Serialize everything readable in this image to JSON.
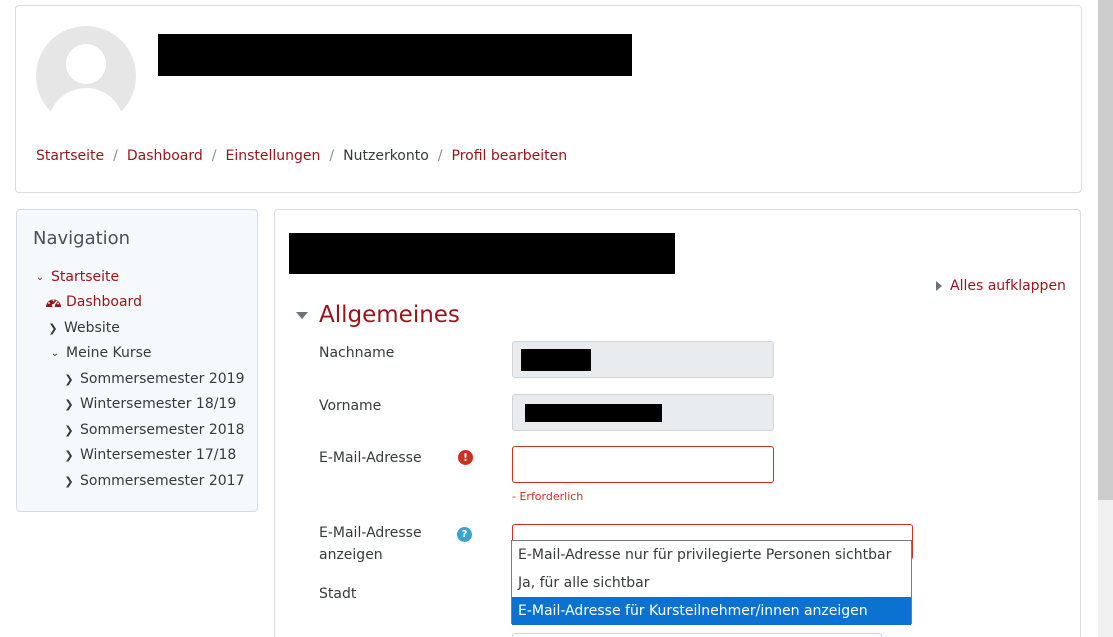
{
  "breadcrumb": {
    "items": [
      "Startseite",
      "Dashboard",
      "Einstellungen",
      "Nutzerkonto",
      "Profil bearbeiten"
    ],
    "separator": "/"
  },
  "navigation": {
    "title": "Navigation",
    "home": "Startseite",
    "dashboard": "Dashboard",
    "website": "Website",
    "my_courses": "Meine Kurse",
    "courses": [
      "Sommersemester 2019",
      "Wintersemester 18/19",
      "Sommersemester 2018",
      "Wintersemester 17/18",
      "Sommersemester 2017"
    ]
  },
  "form": {
    "expand_all": "Alles aufklappen",
    "section_title": "Allgemeines",
    "lastname_label": "Nachname",
    "firstname_label": "Vorname",
    "email_label": "E-Mail-Adresse",
    "email_required_msg": "- Erforderlich",
    "show_email_label_line1": "E-Mail-Adresse",
    "show_email_label_line2": "anzeigen",
    "city_label": "Stadt",
    "show_email_options": [
      "E-Mail-Adresse nur für privilegierte Personen sichtbar",
      "Ja, für alle sichtbar",
      "E-Mail-Adresse für Kursteilnehmer/innen anzeigen"
    ],
    "show_email_selected_index": 2
  },
  "icons": {
    "required": "exclamation-circle-icon",
    "help": "question-circle-icon",
    "dashboard": "tachometer-icon"
  },
  "colors": {
    "link": "#9a1319",
    "error": "#ca3120",
    "help": "#3ba3cf",
    "selected_option": "#0b72d2"
  }
}
